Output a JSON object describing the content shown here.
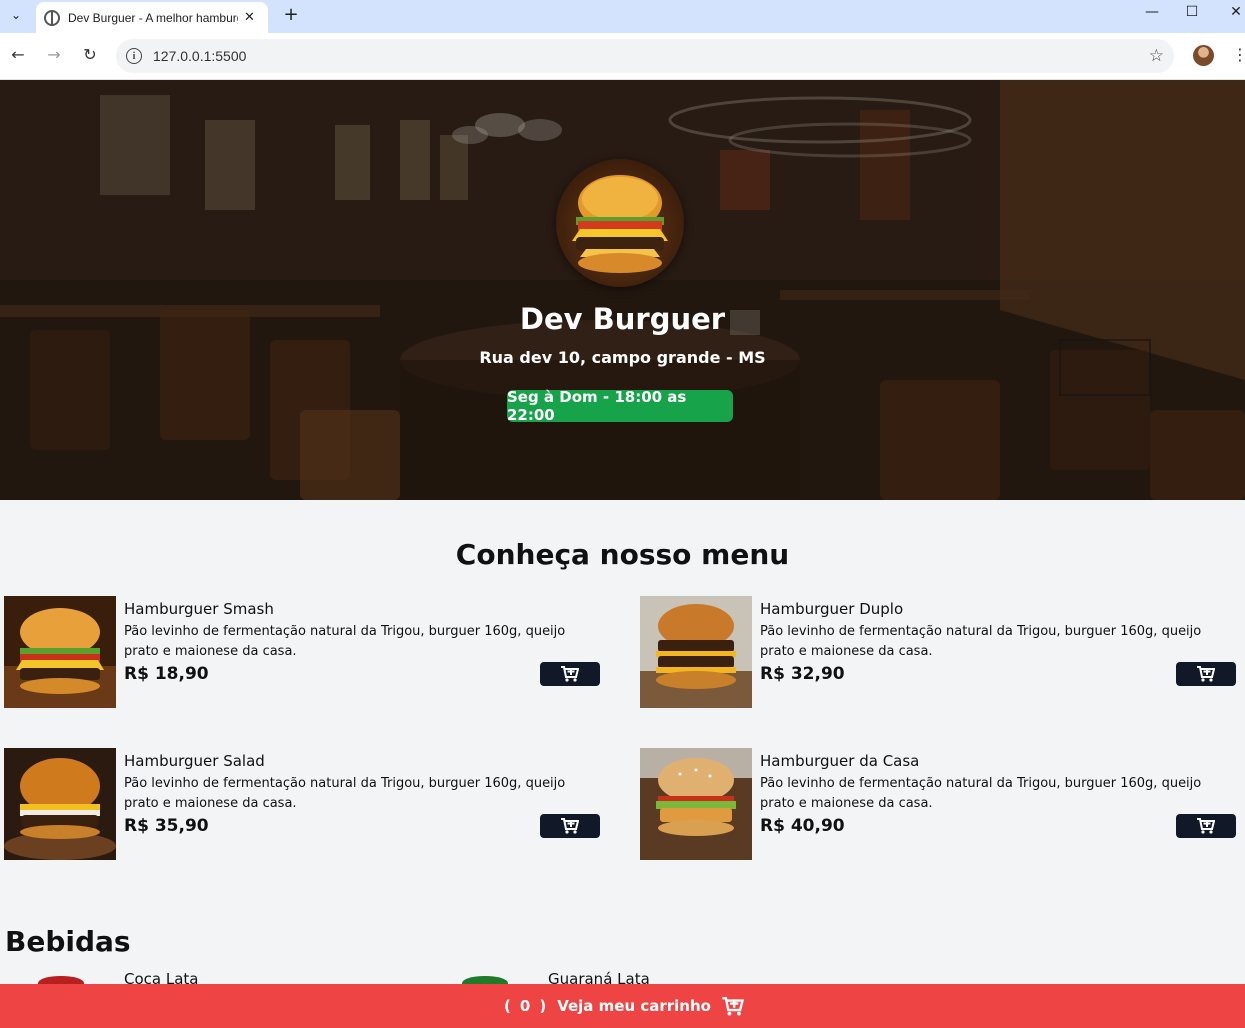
{
  "browser": {
    "tab_title": "Dev Burguer - A melhor hamburgueria",
    "url": "127.0.0.1:5500"
  },
  "hero": {
    "title": "Dev Burguer",
    "address": "Rua dev 10, campo grande - MS",
    "hours": "Seg à Dom - 18:00 as 22:00"
  },
  "menu": {
    "heading": "Conheça nosso menu",
    "items": [
      {
        "name": "Hamburguer Smash",
        "description": "Pão levinho de fermentação natural da Trigou, burguer 160g, queijo prato e maionese da casa.",
        "price": "R$ 18,90"
      },
      {
        "name": "Hamburguer Duplo",
        "description": "Pão levinho de fermentação natural da Trigou, burguer 160g, queijo prato e maionese da casa.",
        "price": "R$ 32,90"
      },
      {
        "name": "Hamburguer Salad",
        "description": "Pão levinho de fermentação natural da Trigou, burguer 160g, queijo prato e maionese da casa.",
        "price": "R$ 35,90"
      },
      {
        "name": "Hamburguer da Casa",
        "description": "Pão levinho de fermentação natural da Trigou, burguer 160g, queijo prato e maionese da casa.",
        "price": "R$ 40,90"
      }
    ]
  },
  "drinks": {
    "heading": "Bebidas",
    "items": [
      {
        "name": "Coca Lata"
      },
      {
        "name": "Guaraná Lata"
      }
    ]
  },
  "cart": {
    "open_paren": "(",
    "count": "0",
    "close_paren": ")",
    "label": "Veja meu carrinho"
  },
  "colors": {
    "hours_badge": "#16a34a",
    "cart_bar": "#ef4444",
    "add_button": "#111827",
    "background": "#f3f4f6"
  },
  "icons": {
    "add_to_cart": "cart-plus-icon",
    "cart_bar": "cart-plus-icon",
    "star": "star-icon"
  }
}
